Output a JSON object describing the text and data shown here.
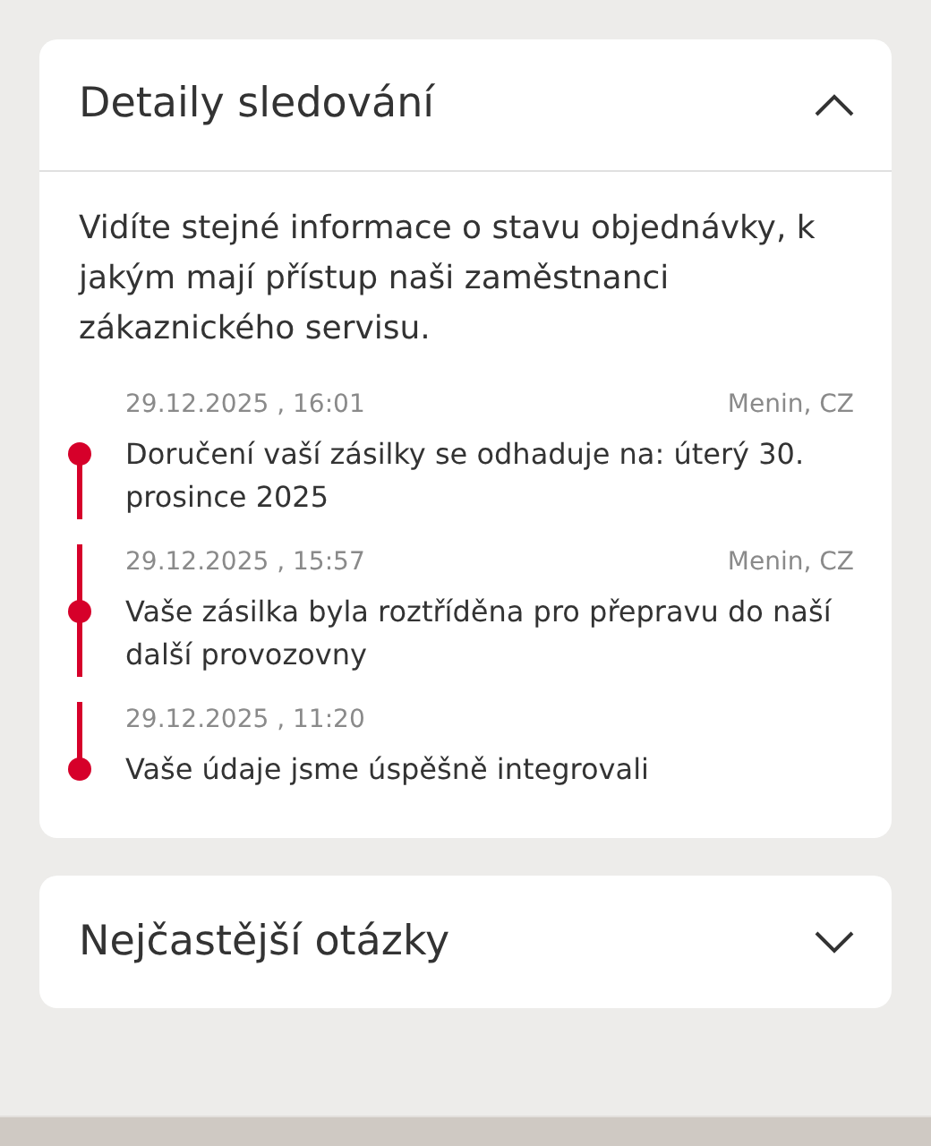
{
  "sections": [
    {
      "title": "Detaily sledování",
      "expanded": true,
      "description": "Vidíte stejné informace o stavu objednávky, k jakým mají přístup naši zaměstnanci zákaznického servisu.",
      "events": [
        {
          "date": "29.12.2025 , 16:01",
          "location": "Menin, CZ",
          "text": "Doručení vaší zásilky se odhaduje na: úterý 30. prosince 2025"
        },
        {
          "date": "29.12.2025 , 15:57",
          "location": "Menin, CZ",
          "text": "Vaše zásilka byla roztříděna pro přepravu do naší další provozovny"
        },
        {
          "date": "29.12.2025 , 11:20",
          "text": "Vaše údaje jsme úspěšně integrovali"
        }
      ]
    },
    {
      "title": "Nejčastější otázky",
      "expanded": false
    }
  ]
}
